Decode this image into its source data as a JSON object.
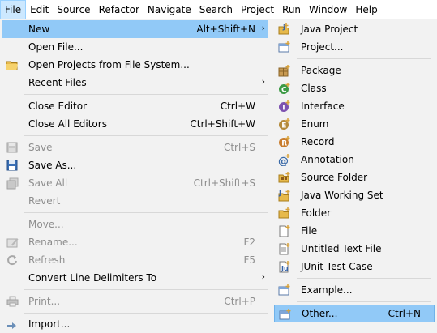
{
  "menubar": [
    "File",
    "Edit",
    "Source",
    "Refactor",
    "Navigate",
    "Search",
    "Project",
    "Run",
    "Window",
    "Help"
  ],
  "file_menu": [
    {
      "label": "New",
      "accel": "Alt+Shift+N",
      "arrow": "›",
      "icon": "",
      "state": "highlight"
    },
    {
      "label": "Open File...",
      "accel": "",
      "arrow": "",
      "icon": "",
      "state": ""
    },
    {
      "label": "Open Projects from File System...",
      "accel": "",
      "arrow": "",
      "icon": "folder-icon",
      "state": ""
    },
    {
      "label": "Recent Files",
      "accel": "",
      "arrow": "›",
      "icon": "",
      "state": ""
    },
    {
      "label": "Close Editor",
      "accel": "Ctrl+W",
      "arrow": "",
      "icon": "",
      "state": ""
    },
    {
      "label": "Close All Editors",
      "accel": "Ctrl+Shift+W",
      "arrow": "",
      "icon": "",
      "state": ""
    },
    {
      "label": "Save",
      "accel": "Ctrl+S",
      "arrow": "",
      "icon": "save-icon",
      "state": "disabled"
    },
    {
      "label": "Save As...",
      "accel": "",
      "arrow": "",
      "icon": "save-as-icon",
      "state": ""
    },
    {
      "label": "Save All",
      "accel": "Ctrl+Shift+S",
      "arrow": "",
      "icon": "save-all-icon",
      "state": "disabled"
    },
    {
      "label": "Revert",
      "accel": "",
      "arrow": "",
      "icon": "",
      "state": "disabled"
    },
    {
      "label": "Move...",
      "accel": "",
      "arrow": "",
      "icon": "",
      "state": "disabled"
    },
    {
      "label": "Rename...",
      "accel": "F2",
      "arrow": "",
      "icon": "rename-icon",
      "state": "disabled"
    },
    {
      "label": "Refresh",
      "accel": "F5",
      "arrow": "",
      "icon": "refresh-icon",
      "state": "disabled"
    },
    {
      "label": "Convert Line Delimiters To",
      "accel": "",
      "arrow": "›",
      "icon": "",
      "state": ""
    },
    {
      "label": "Print...",
      "accel": "Ctrl+P",
      "arrow": "",
      "icon": "print-icon",
      "state": "disabled"
    },
    {
      "label": "Import...",
      "accel": "",
      "arrow": "",
      "icon": "import-icon",
      "state": ""
    }
  ],
  "new_submenu": [
    {
      "label": "Java Project",
      "accel": "",
      "icon": "java-project-icon",
      "state": ""
    },
    {
      "label": "Project...",
      "accel": "",
      "icon": "project-icon",
      "state": ""
    },
    {
      "label": "Package",
      "accel": "",
      "icon": "package-icon",
      "state": ""
    },
    {
      "label": "Class",
      "accel": "",
      "icon": "class-icon",
      "state": ""
    },
    {
      "label": "Interface",
      "accel": "",
      "icon": "interface-icon",
      "state": ""
    },
    {
      "label": "Enum",
      "accel": "",
      "icon": "enum-icon",
      "state": ""
    },
    {
      "label": "Record",
      "accel": "",
      "icon": "record-icon",
      "state": ""
    },
    {
      "label": "Annotation",
      "accel": "",
      "icon": "annotation-icon",
      "state": ""
    },
    {
      "label": "Source Folder",
      "accel": "",
      "icon": "source-folder-icon",
      "state": ""
    },
    {
      "label": "Java Working Set",
      "accel": "",
      "icon": "working-set-icon",
      "state": ""
    },
    {
      "label": "Folder",
      "accel": "",
      "icon": "folder-icon",
      "state": ""
    },
    {
      "label": "File",
      "accel": "",
      "icon": "file-icon",
      "state": ""
    },
    {
      "label": "Untitled Text File",
      "accel": "",
      "icon": "text-file-icon",
      "state": ""
    },
    {
      "label": "JUnit Test Case",
      "accel": "",
      "icon": "junit-icon",
      "state": ""
    },
    {
      "label": "Example...",
      "accel": "",
      "icon": "example-icon",
      "state": ""
    },
    {
      "label": "Other...",
      "accel": "Ctrl+N",
      "icon": "other-wizard-icon",
      "state": "highlight"
    }
  ],
  "colors": {
    "highlight": "#91c9f7",
    "menubar_active": "#cce8ff",
    "disabled_text": "#8e8e8e"
  }
}
